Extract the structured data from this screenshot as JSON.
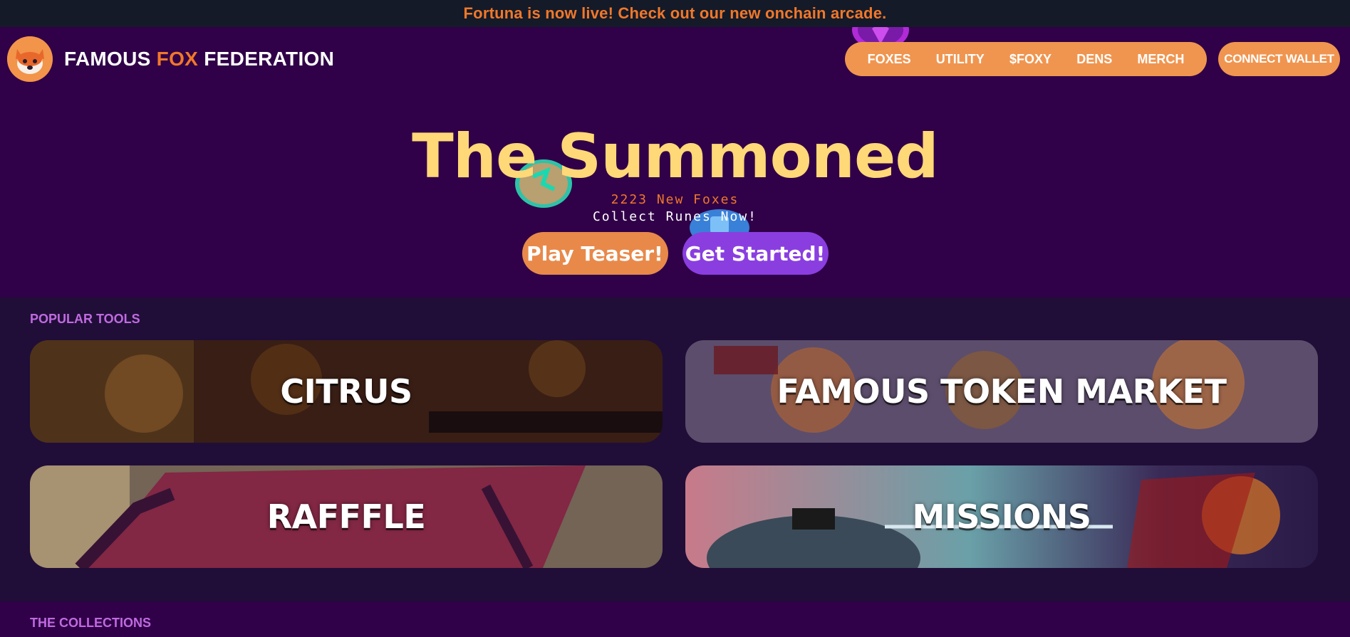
{
  "announcement": "Fortuna is now live! Check out our new onchain arcade.",
  "brand": {
    "part1": "FAMOUS ",
    "part2": "FOX",
    "part3": " FEDERATION",
    "logo_icon": "fox-logo-icon"
  },
  "nav": {
    "links": [
      "FOXES",
      "UTILITY",
      "$FOXY",
      "DENS",
      "MERCH"
    ],
    "connect": "CONNECT WALLET"
  },
  "hero": {
    "title": "The Summoned",
    "subtitle": "2223 New Foxes",
    "tagline": "Collect Runes Now!",
    "buttons": {
      "teaser": "Play Teaser!",
      "start": "Get Started!"
    }
  },
  "tools": {
    "label": "POPULAR TOOLS",
    "cards": [
      "CITRUS",
      "FAMOUS TOKEN MARKET",
      "RAFFFLE",
      "MISSIONS"
    ]
  },
  "collections": {
    "label": "THE COLLECTIONS"
  },
  "colors": {
    "bg": "#300048",
    "accent": "#f0782a",
    "pill": "#f0954f",
    "title": "#ffd877",
    "purple_button": "#8a3ee0",
    "section_bg": "#200e38",
    "section_label": "#c06ae0"
  }
}
